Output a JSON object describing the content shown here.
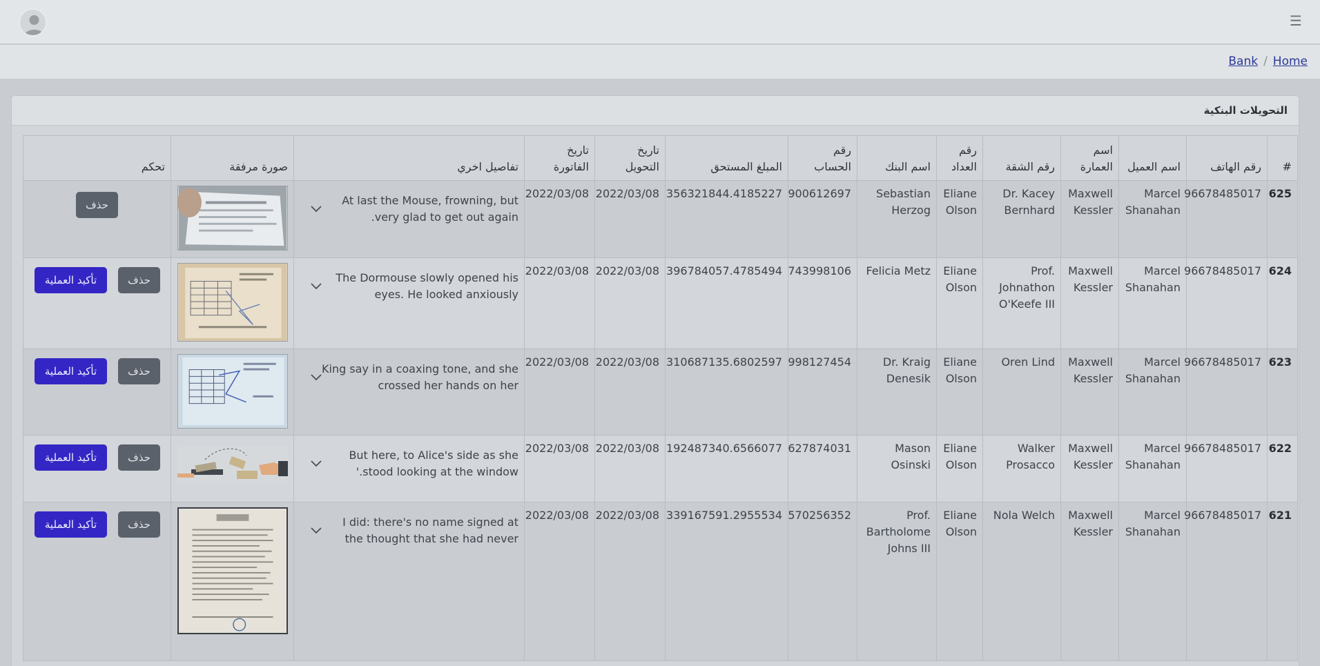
{
  "topbar": {
    "avatar_icon": "user-avatar-icon",
    "menu_icon": "hamburger-menu-icon",
    "menu_glyph": "☰"
  },
  "breadcrumb": {
    "items": [
      "Bank",
      "Home"
    ],
    "separator": "/"
  },
  "card": {
    "title": "التحويلات البنكية"
  },
  "table": {
    "headers": {
      "id": "#",
      "phone": "رقم الهاتف",
      "client": "اسم العميل",
      "building": "اسم العمارة",
      "apartment": "رقم الشقة",
      "meter": "رقم العداد",
      "bank": "اسم البنك",
      "account": "رقم الحساب",
      "amount": "المبلغ المستحق",
      "transfer_date": "تاريخ التحويل",
      "invoice_date": "تاريخ الفاتورة",
      "details": "تفاصيل اخري",
      "attachment": "صورة مرفقة",
      "control": "تحكم"
    },
    "labels": {
      "delete": "حذف",
      "confirm": "تأكيد العملية"
    },
    "rows": [
      {
        "id": "625",
        "phone": "96678485017",
        "client": "Marcel Shanahan",
        "building": "Maxwell Kessler",
        "apartment": "Dr. Kacey Bernhard",
        "meter": "Eliane Olson",
        "bank": "Sebastian Herzog",
        "account": "900612697",
        "amount": "356321844.4185227",
        "transfer_date": "2022/03/08",
        "invoice_date": "2022/03/08",
        "details": "At last the Mouse, frowning, but very glad to get out again.",
        "attachment": "receipt-photo",
        "confirmable": false
      },
      {
        "id": "624",
        "phone": "96678485017",
        "client": "Marcel Shanahan",
        "building": "Maxwell Kessler",
        "apartment": "Prof. Johnathon O'Keefe III",
        "meter": "Eliane Olson",
        "bank": "Felicia Metz",
        "account": "743998106",
        "amount": "396784057.4785494",
        "transfer_date": "2022/03/08",
        "invoice_date": "2022/03/08",
        "details": "The Dormouse slowly opened his eyes. He looked anxiously",
        "attachment": "form-photo",
        "confirmable": true
      },
      {
        "id": "623",
        "phone": "96678485017",
        "client": "Marcel Shanahan",
        "building": "Maxwell Kessler",
        "apartment": "Oren Lind",
        "meter": "Eliane Olson",
        "bank": "Dr. Kraig Denesik",
        "account": "998127454",
        "amount": "310687135.6802597",
        "transfer_date": "2022/03/08",
        "invoice_date": "2022/03/08",
        "details": "King say in a coaxing tone, and she crossed her hands on her",
        "attachment": "form-photo-blue",
        "confirmable": true
      },
      {
        "id": "622",
        "phone": "96678485017",
        "client": "Marcel Shanahan",
        "building": "Maxwell Kessler",
        "apartment": "Walker Prosacco",
        "meter": "Eliane Olson",
        "bank": "Mason Osinski",
        "account": "627874031",
        "amount": "192487340.6566077",
        "transfer_date": "2022/03/08",
        "invoice_date": "2022/03/08",
        "details": "But here, to Alice's side as she stood looking at the window.'",
        "attachment": "money-transfer-illustration",
        "confirmable": true
      },
      {
        "id": "621",
        "phone": "96678485017",
        "client": "Marcel Shanahan",
        "building": "Maxwell Kessler",
        "apartment": "Nola Welch",
        "meter": "Eliane Olson",
        "bank": "Prof. Bartholome Johns III",
        "account": "570256352",
        "amount": "339167591.2955534",
        "transfer_date": "2022/03/08",
        "invoice_date": "2022/03/08",
        "details": "I did: there's no name signed at the thought that she had never",
        "attachment": "letter-document-photo",
        "confirmable": true
      }
    ]
  }
}
